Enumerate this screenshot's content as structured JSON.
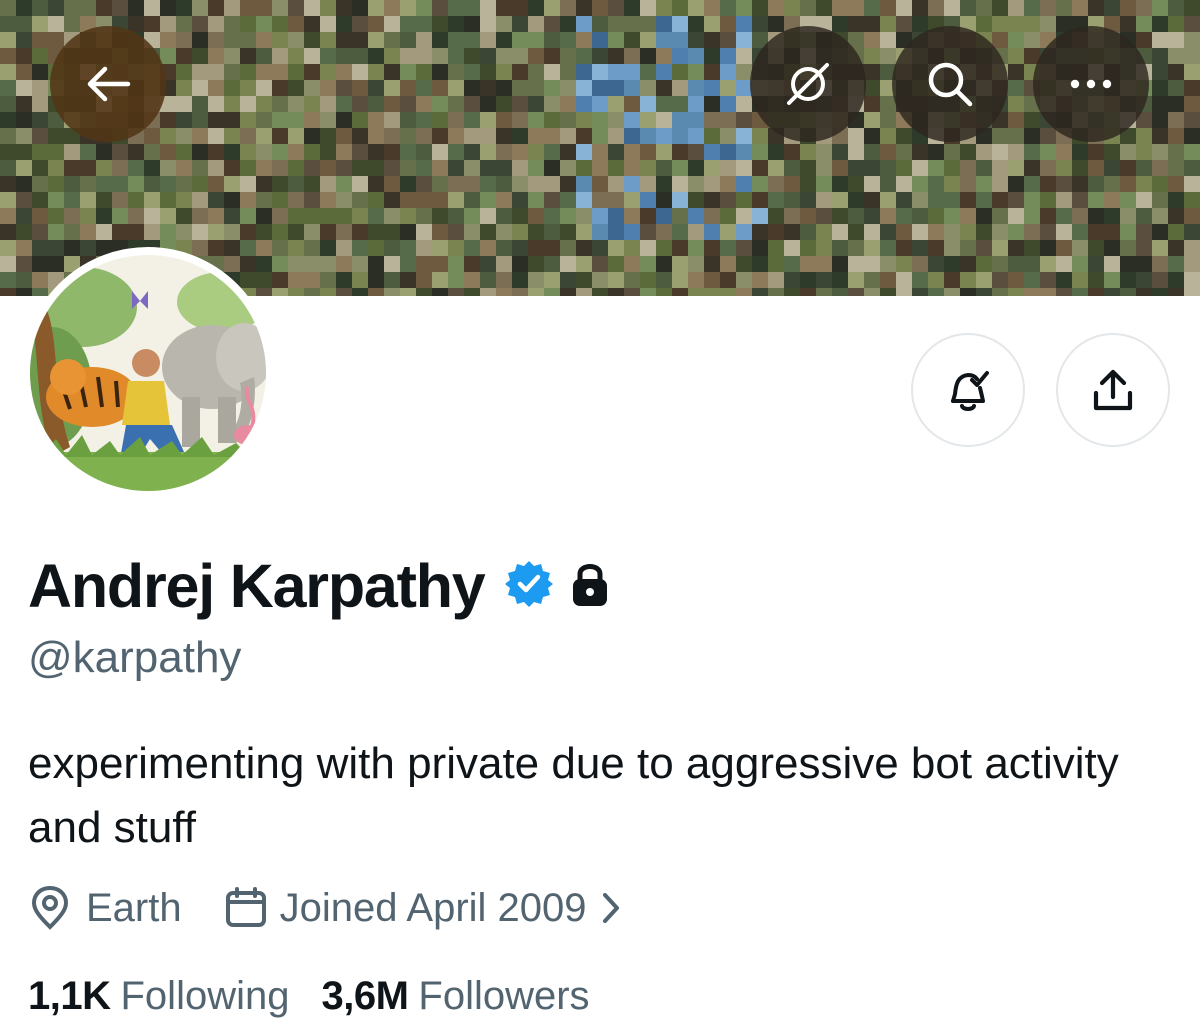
{
  "header": {
    "back_icon": "arrow-left-icon",
    "translate_icon": "slashed-circle-icon",
    "search_icon": "search-icon",
    "more_icon": "more-horizontal-icon"
  },
  "profile": {
    "display_name": "Andrej Karpathy",
    "handle": "@karpathy",
    "verified": true,
    "protected": true,
    "bio": "experimenting with private due to aggressive bot activity and stuff",
    "location": "Earth",
    "joined": "Joined April 2009"
  },
  "stats": {
    "following_count": "1,1K",
    "following_label": "Following",
    "followers_count": "3,6M",
    "followers_label": "Followers"
  },
  "actions": {
    "notify_icon": "bell-check-icon",
    "share_icon": "share-icon"
  },
  "colors": {
    "text_primary": "#0f1419",
    "text_secondary": "#536471",
    "verified_blue": "#1d9bf0",
    "button_border": "#e3e7ea"
  }
}
